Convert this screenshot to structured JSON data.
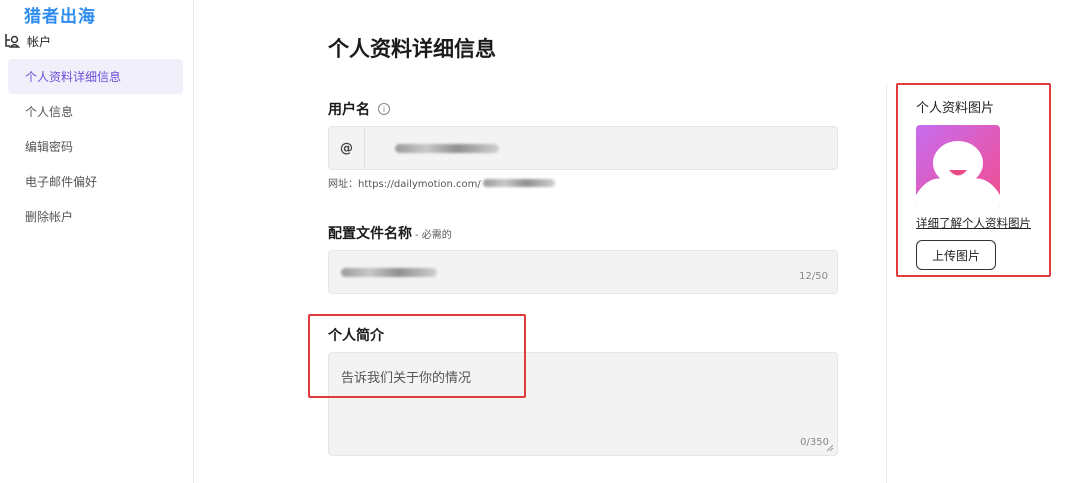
{
  "watermark": "猎者出海",
  "sidebar": {
    "section_label": "帐户",
    "items": [
      {
        "label": "个人资料详细信息",
        "active": true
      },
      {
        "label": "个人信息",
        "active": false
      },
      {
        "label": "编辑密码",
        "active": false
      },
      {
        "label": "电子邮件偏好",
        "active": false
      },
      {
        "label": "删除帐户",
        "active": false
      }
    ]
  },
  "main": {
    "title": "个人资料详细信息",
    "username": {
      "label": "用户名",
      "prefix": "@",
      "url_prefix": "网址：https://dailymotion.com/"
    },
    "profile_name": {
      "label": "配置文件名称",
      "required": "- 必需的",
      "count": "12/50"
    },
    "bio": {
      "label": "个人简介",
      "placeholder": "告诉我们关于你的情况",
      "count": "0/350"
    }
  },
  "right_panel": {
    "title": "个人资料图片",
    "learn_more": "详细了解个人资料图片",
    "upload_button": "上传图片"
  },
  "colors": {
    "accent": "#6b4fd8",
    "active_bg": "#f1effa",
    "highlight_box": "#e23b3b",
    "watermark": "#2d8cf0"
  }
}
